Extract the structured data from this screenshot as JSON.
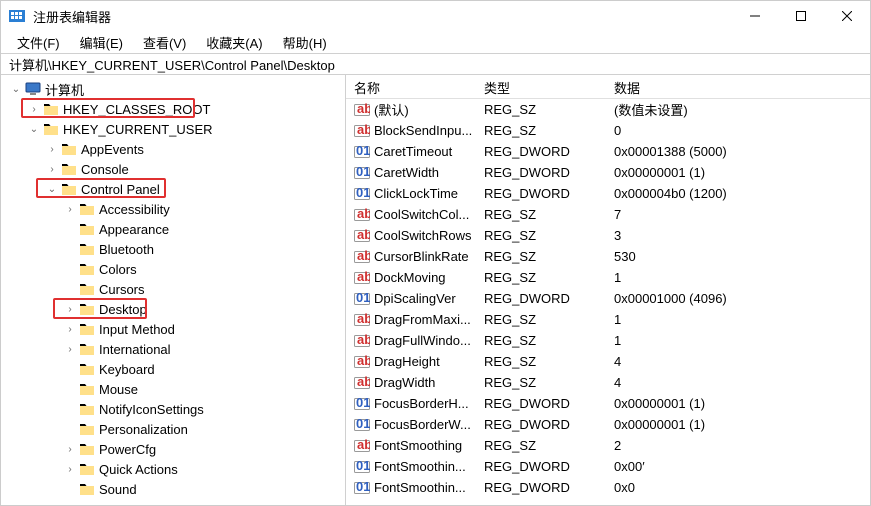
{
  "window": {
    "title": "注册表编辑器"
  },
  "menu": {
    "file": "文件(F)",
    "edit": "编辑(E)",
    "view": "查看(V)",
    "favorites": "收藏夹(A)",
    "help": "帮助(H)"
  },
  "address": "计算机\\HKEY_CURRENT_USER\\Control Panel\\Desktop",
  "tree": {
    "root": "计算机",
    "hkcr": "HKEY_CLASSES_ROOT",
    "hkcu": "HKEY_CURRENT_USER",
    "appevents": "AppEvents",
    "console": "Console",
    "controlpanel": "Control Panel",
    "accessibility": "Accessibility",
    "appearance": "Appearance",
    "bluetooth": "Bluetooth",
    "colors": "Colors",
    "cursors": "Cursors",
    "desktop": "Desktop",
    "inputmethod": "Input Method",
    "international": "International",
    "keyboard": "Keyboard",
    "mouse": "Mouse",
    "notifyicon": "NotifyIconSettings",
    "personalization": "Personalization",
    "powercfg": "PowerCfg",
    "quickactions": "Quick Actions",
    "sound": "Sound"
  },
  "columns": {
    "name": "名称",
    "type": "类型",
    "data": "数据"
  },
  "values": [
    {
      "icon": "sz",
      "name": "(默认)",
      "type": "REG_SZ",
      "data": "(数值未设置)"
    },
    {
      "icon": "sz",
      "name": "BlockSendInpu...",
      "type": "REG_SZ",
      "data": "0"
    },
    {
      "icon": "dw",
      "name": "CaretTimeout",
      "type": "REG_DWORD",
      "data": "0x00001388 (5000)"
    },
    {
      "icon": "dw",
      "name": "CaretWidth",
      "type": "REG_DWORD",
      "data": "0x00000001 (1)"
    },
    {
      "icon": "dw",
      "name": "ClickLockTime",
      "type": "REG_DWORD",
      "data": "0x000004b0 (1200)"
    },
    {
      "icon": "sz",
      "name": "CoolSwitchCol...",
      "type": "REG_SZ",
      "data": "7"
    },
    {
      "icon": "sz",
      "name": "CoolSwitchRows",
      "type": "REG_SZ",
      "data": "3"
    },
    {
      "icon": "sz",
      "name": "CursorBlinkRate",
      "type": "REG_SZ",
      "data": "530"
    },
    {
      "icon": "sz",
      "name": "DockMoving",
      "type": "REG_SZ",
      "data": "1"
    },
    {
      "icon": "dw",
      "name": "DpiScalingVer",
      "type": "REG_DWORD",
      "data": "0x00001000 (4096)"
    },
    {
      "icon": "sz",
      "name": "DragFromMaxi...",
      "type": "REG_SZ",
      "data": "1"
    },
    {
      "icon": "sz",
      "name": "DragFullWindo...",
      "type": "REG_SZ",
      "data": "1"
    },
    {
      "icon": "sz",
      "name": "DragHeight",
      "type": "REG_SZ",
      "data": "4"
    },
    {
      "icon": "sz",
      "name": "DragWidth",
      "type": "REG_SZ",
      "data": "4"
    },
    {
      "icon": "dw",
      "name": "FocusBorderH...",
      "type": "REG_DWORD",
      "data": "0x00000001 (1)"
    },
    {
      "icon": "dw",
      "name": "FocusBorderW...",
      "type": "REG_DWORD",
      "data": "0x00000001 (1)"
    },
    {
      "icon": "sz",
      "name": "FontSmoothing",
      "type": "REG_SZ",
      "data": "2"
    },
    {
      "icon": "dw",
      "name": "FontSmoothin...",
      "type": "REG_DWORD",
      "data": "0x00′"
    },
    {
      "icon": "dw",
      "name": "FontSmoothin...",
      "type": "REG_DWORD",
      "data": "0x0"
    }
  ]
}
